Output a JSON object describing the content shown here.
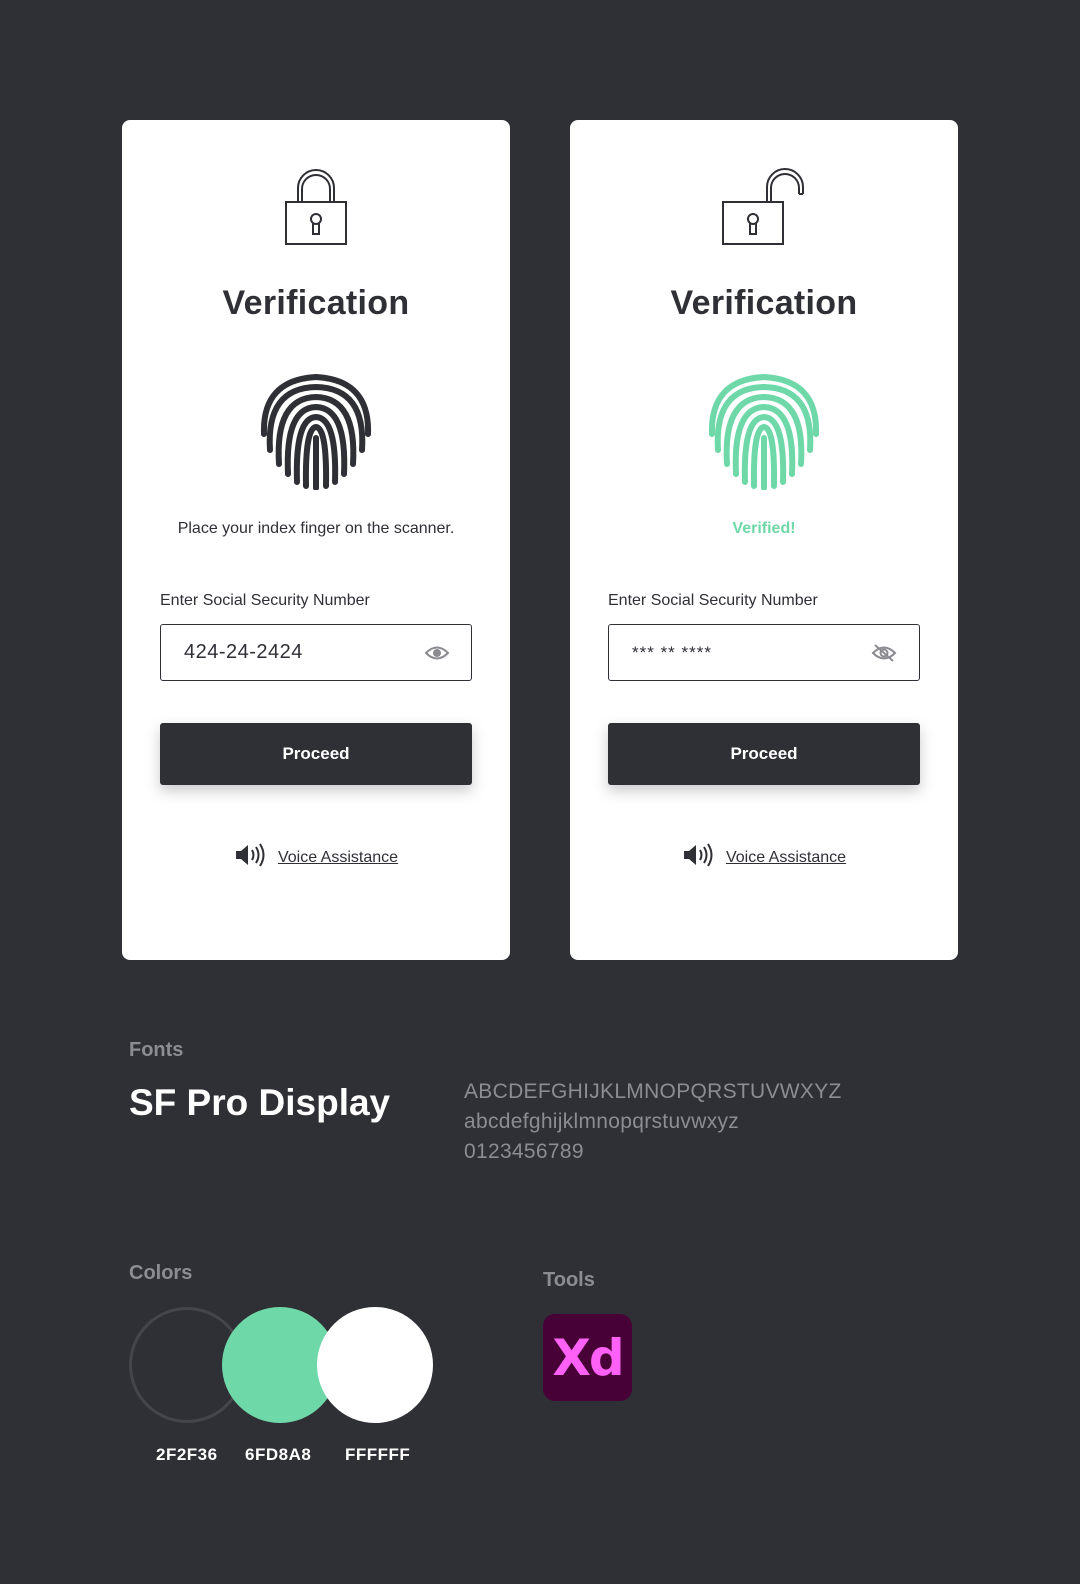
{
  "cards": [
    {
      "state": "locked",
      "title": "Verification",
      "message": "Place your index finger on the scanner.",
      "ssn_label": "Enter Social Security Number",
      "ssn_value": "424-24-2424",
      "toggle_icon": "eye-icon",
      "proceed_label": "Proceed",
      "voice_label": "Voice Assistance",
      "fingerprint_color": "#2f2f36"
    },
    {
      "state": "unlocked",
      "title": "Verification",
      "message": "Verified!",
      "ssn_label": "Enter Social Security Number",
      "ssn_value": "*** ** ****",
      "toggle_icon": "eye-off-icon",
      "proceed_label": "Proceed",
      "voice_label": "Voice Assistance",
      "fingerprint_color": "#6fd8a8"
    }
  ],
  "fonts": {
    "heading": "Fonts",
    "name": "SF Pro Display",
    "uppercase": "ABCDEFGHIJKLMNOPQRSTUVWXYZ",
    "lowercase": "abcdefghijklmnopqrstuvwxyz",
    "digits": "0123456789"
  },
  "colors": {
    "heading": "Colors",
    "swatches": [
      {
        "code": "2F2F36",
        "hex": "#2f2f36"
      },
      {
        "code": "6FD8A8",
        "hex": "#6fd8a8"
      },
      {
        "code": "FFFFFF",
        "hex": "#ffffff"
      }
    ]
  },
  "tools": {
    "heading": "Tools",
    "items": [
      {
        "name": "Xd",
        "icon": "adobe-xd-logo"
      }
    ]
  }
}
